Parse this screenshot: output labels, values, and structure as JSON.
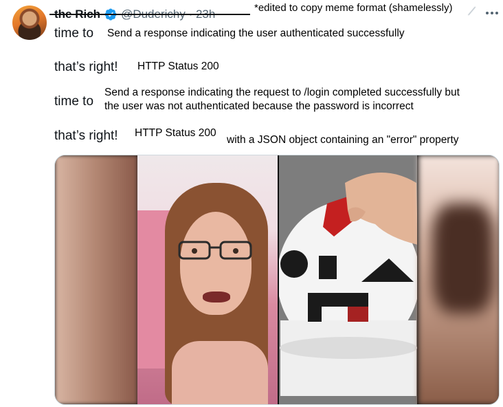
{
  "tweet": {
    "display_name": "the Rich",
    "handle_time": "@Duderichy · 23h",
    "edited_note": "*edited to copy meme format (shamelessly)"
  },
  "meme": {
    "rows": [
      {
        "label": "time to",
        "overlay": "Send a response indicating the user authenticated successfully"
      },
      {
        "label": "that’s right!",
        "overlay": "HTTP Status 200"
      },
      {
        "label": "time to",
        "overlay_line1": "Send a response indicating the request to /login completed successfully but",
        "overlay_line2": "the user was not authenticated because the password is incorrect"
      },
      {
        "label": "that’s right!",
        "overlay": "HTTP Status 200",
        "extra": "with a JSON object containing an \"error\" property"
      }
    ]
  },
  "icons": {
    "avatar": "avatar",
    "verified": "verified-badge-icon",
    "more": "more-options-icon"
  },
  "colors": {
    "verified": "#1d9bf0",
    "handle": "#536471",
    "text": "#0f1419"
  }
}
